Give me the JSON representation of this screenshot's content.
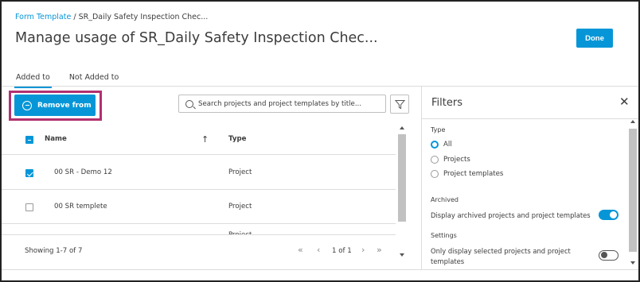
{
  "header": {
    "breadcrumb_link": "Form Template",
    "breadcrumb_sep": " / ",
    "breadcrumb_current": "SR_Daily Safety Inspection Chec...",
    "title": "Manage usage of SR_Daily Safety Inspection Chec...",
    "done_label": "Done"
  },
  "tabs": [
    {
      "label": "Added to",
      "active": true
    },
    {
      "label": "Not Added to",
      "active": false
    }
  ],
  "toolbar": {
    "remove_label": "Remove from",
    "search_placeholder": "Search projects and project templates by title..."
  },
  "table": {
    "columns": [
      "Name",
      "Type"
    ],
    "rows": [
      {
        "name": "00 SR - Demo 12",
        "type": "Project",
        "checked": true
      },
      {
        "name": "00 SR templete",
        "type": "Project",
        "checked": false
      },
      {
        "name": "",
        "type": "Project",
        "checked": false
      }
    ],
    "showing": "Showing 1-7 of 7",
    "page_label": "1 of 1"
  },
  "filters": {
    "title": "Filters",
    "type_label": "Type",
    "type_options": [
      {
        "label": "All",
        "selected": true
      },
      {
        "label": "Projects",
        "selected": false
      },
      {
        "label": "Project templates",
        "selected": false
      }
    ],
    "archived_label": "Archived",
    "archived_text": "Display archived projects and project templates",
    "archived_on": true,
    "settings_label": "Settings",
    "settings_text_line1": "Only display selected projects and project",
    "settings_text_line2": "templates",
    "settings_on": false
  },
  "colors": {
    "accent": "#0696d7",
    "highlight": "#b2306f"
  }
}
